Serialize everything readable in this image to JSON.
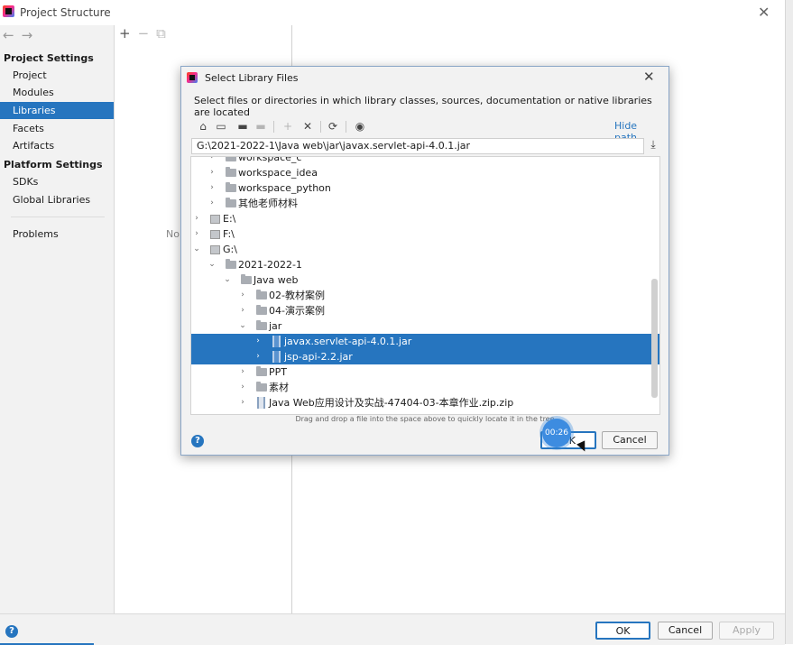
{
  "window": {
    "title": "Project Structure"
  },
  "nav": {
    "back_icon": "arrow-left-icon",
    "forward_icon": "arrow-right-icon"
  },
  "sidebar": {
    "project_settings_title": "Project Settings",
    "project_items": [
      {
        "label": "Project"
      },
      {
        "label": "Modules"
      },
      {
        "label": "Libraries",
        "selected": true
      },
      {
        "label": "Facets"
      },
      {
        "label": "Artifacts"
      }
    ],
    "platform_settings_title": "Platform Settings",
    "platform_items": [
      {
        "label": "SDKs"
      },
      {
        "label": "Global Libraries"
      }
    ],
    "other_items": [
      {
        "label": "Problems"
      }
    ]
  },
  "middle": {
    "toolbar": [
      "+",
      "−",
      "⧉"
    ],
    "empty_text": "No"
  },
  "bottom": {
    "ok_label": "OK",
    "cancel_label": "Cancel",
    "apply_label": "Apply"
  },
  "dialog": {
    "title": "Select Library Files",
    "description": "Select files or directories in which library classes, sources, documentation or native libraries are located",
    "hide_path_label": "Hide path",
    "path_value": "G:\\2021-2022-1\\Java web\\jar\\javax.servlet-api-4.0.1.jar",
    "tree": [
      {
        "label": "workspace_c",
        "type": "folder",
        "arrow": "›"
      },
      {
        "label": "workspace_idea",
        "type": "folder",
        "arrow": "›"
      },
      {
        "label": "workspace_python",
        "type": "folder",
        "arrow": "›"
      },
      {
        "label": "其他老师材料",
        "type": "folder",
        "arrow": "›"
      },
      {
        "label": "E:\\",
        "type": "drive",
        "arrow": "›"
      },
      {
        "label": "F:\\",
        "type": "drive",
        "arrow": "›"
      },
      {
        "label": "G:\\",
        "type": "drive",
        "arrow": "⌄"
      },
      {
        "label": "2021-2022-1",
        "type": "folder",
        "arrow": "⌄"
      },
      {
        "label": "Java web",
        "type": "folder",
        "arrow": "⌄"
      },
      {
        "label": "02-教材案例",
        "type": "folder",
        "arrow": "›"
      },
      {
        "label": "04-演示案例",
        "type": "folder",
        "arrow": "›"
      },
      {
        "label": "jar",
        "type": "folder",
        "arrow": "⌄"
      },
      {
        "label": "javax.servlet-api-4.0.1.jar",
        "type": "jar",
        "arrow": "›",
        "selected": true
      },
      {
        "label": "jsp-api-2.2.jar",
        "type": "jar",
        "arrow": "›",
        "selected": true
      },
      {
        "label": "PPT",
        "type": "folder",
        "arrow": "›"
      },
      {
        "label": "素材",
        "type": "folder",
        "arrow": "›"
      },
      {
        "label": "Java Web应用设计及实战-47404-03-本章作业.zip.zip",
        "type": "jar",
        "arrow": "›"
      }
    ],
    "hint": "Drag and drop a file into the space above to quickly locate it in the tree",
    "ok_label": "OK",
    "cancel_label": "Cancel",
    "timer": "00:26"
  }
}
